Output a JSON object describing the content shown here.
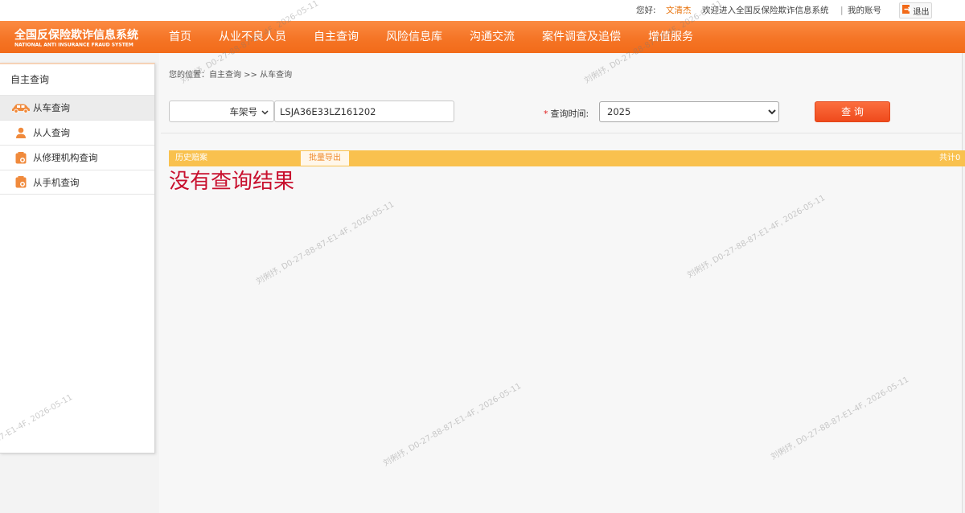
{
  "topbar": {
    "greeting": "您好:",
    "username": "文清杰",
    "welcome": "欢迎进入全国反保险欺诈信息系统",
    "divider": "|",
    "my_account": "我的账号",
    "logout": "退出",
    "logout_icon": "logout-icon"
  },
  "logo": {
    "title": "全国反保险欺诈信息系统",
    "subtitle": "NATIONAL ANTI INSURANCE FRAUD SYSTEM"
  },
  "nav": {
    "items": [
      {
        "label": "首页"
      },
      {
        "label": "从业不良人员"
      },
      {
        "label": "自主查询"
      },
      {
        "label": "风险信息库"
      },
      {
        "label": "沟通交流"
      },
      {
        "label": "案件调查及追偿"
      },
      {
        "label": "增值服务"
      }
    ]
  },
  "sidebar": {
    "title": "自主查询",
    "items": [
      {
        "label": "从车查询",
        "icon": "car-icon",
        "active": true
      },
      {
        "label": "从人查询",
        "icon": "person-icon",
        "active": false
      },
      {
        "label": "从修理机构查询",
        "icon": "document-icon",
        "active": false
      },
      {
        "label": "从手机查询",
        "icon": "document-icon",
        "active": false
      }
    ]
  },
  "breadcrumb": "您的位置：自主查询 >> 从车查询",
  "search": {
    "field_type": "车架号",
    "vin_value": "LSJA36E33LZ161202",
    "required_mark": "*",
    "time_label": "查询时间:",
    "time_value": "2025",
    "submit_label": "查 询"
  },
  "results": {
    "section_title": "历史赔案",
    "export_label": "批量导出",
    "total_text": "共计0",
    "empty_message": "没有查询结果"
  },
  "watermark": {
    "text": "刘俐抒, D0-27-88-87-E1-4F, 2026-05-11"
  },
  "colors": {
    "nav_orange": "#f57526",
    "username_orange": "#e8730c",
    "result_bar_yellow": "#f9c14e",
    "empty_message_red": "#c8102e",
    "query_button_red": "#ef4a1c",
    "icon_orange": "#f08a3c"
  }
}
